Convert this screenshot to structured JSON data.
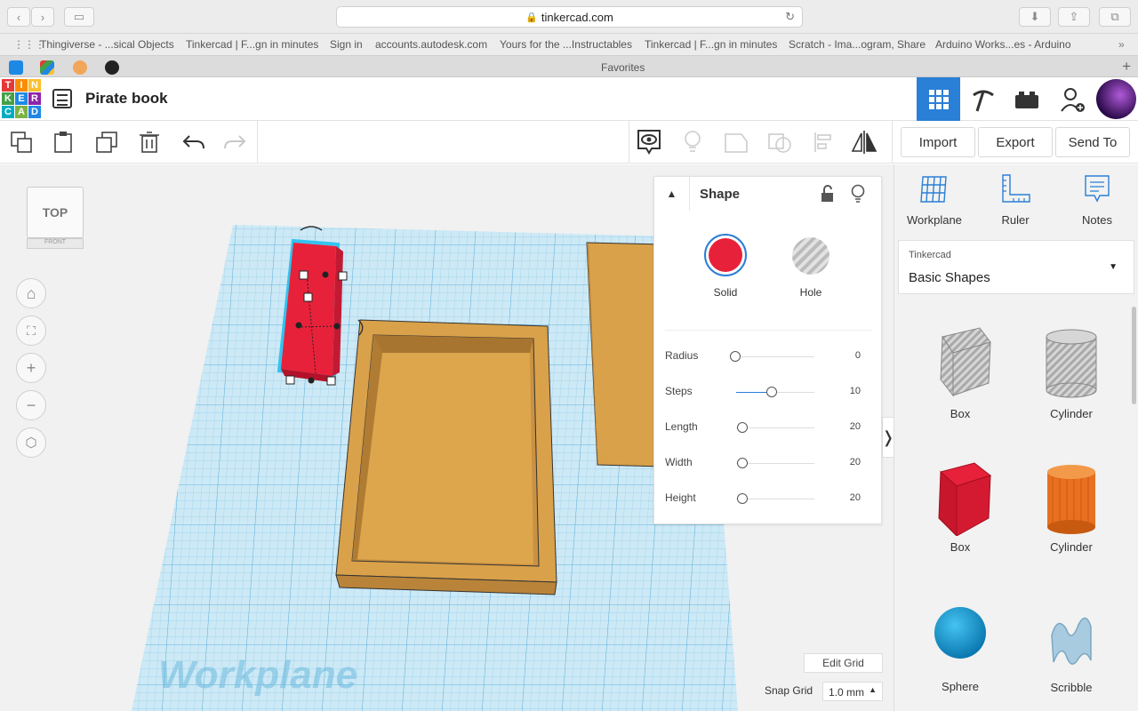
{
  "browser": {
    "url": "tinkercad.com",
    "favorites_label": "Favorites",
    "bookmarks": [
      "Thingiverse - ...sical Objects",
      "Tinkercad | F...gn in minutes",
      "Sign in",
      "accounts.autodesk.com",
      "Yours for the ...Instructables",
      "Tinkercad | F...gn in minutes",
      "Scratch - Ima...ogram, Share",
      "Arduino Works...es - Arduino"
    ]
  },
  "app": {
    "logo_letters": [
      "T",
      "I",
      "N",
      "K",
      "E",
      "R",
      "C",
      "A",
      "D"
    ],
    "project_title": "Pirate book"
  },
  "toolbar": {
    "import_label": "Import",
    "export_label": "Export",
    "send_to_label": "Send To"
  },
  "viewcube": {
    "top_label": "TOP",
    "front_label": "FRONT"
  },
  "workplane": {
    "label": "Workplane",
    "edit_grid_label": "Edit Grid",
    "snap_grid_label": "Snap Grid",
    "snap_grid_value": "1.0 mm"
  },
  "shape_panel": {
    "title": "Shape",
    "solid_label": "Solid",
    "hole_label": "Hole",
    "params": [
      {
        "label": "Radius",
        "value": "0",
        "fraction": 0.0
      },
      {
        "label": "Steps",
        "value": "10",
        "fraction": 0.45
      },
      {
        "label": "Length",
        "value": "20",
        "fraction": 0.1
      },
      {
        "label": "Width",
        "value": "20",
        "fraction": 0.1
      },
      {
        "label": "Height",
        "value": "20",
        "fraction": 0.1
      }
    ],
    "solid_color": "#e8213a"
  },
  "right_panel": {
    "tools": [
      {
        "label": "Workplane"
      },
      {
        "label": "Ruler"
      },
      {
        "label": "Notes"
      }
    ],
    "library_source": "Tinkercad",
    "library_name": "Basic Shapes",
    "shapes": [
      {
        "label": "Box",
        "icon": "box-hole-icon"
      },
      {
        "label": "Cylinder",
        "icon": "cylinder-hole-icon"
      },
      {
        "label": "Box",
        "icon": "box-red-icon"
      },
      {
        "label": "Cylinder",
        "icon": "cylinder-orange-icon"
      },
      {
        "label": "Sphere",
        "icon": "sphere-blue-icon"
      },
      {
        "label": "Scribble",
        "icon": "scribble-icon"
      }
    ]
  },
  "colors": {
    "accent": "#2a7fd6",
    "selected_box": "#e8213a",
    "wood": "#d9a14a",
    "grid": "#bfe3f3"
  }
}
